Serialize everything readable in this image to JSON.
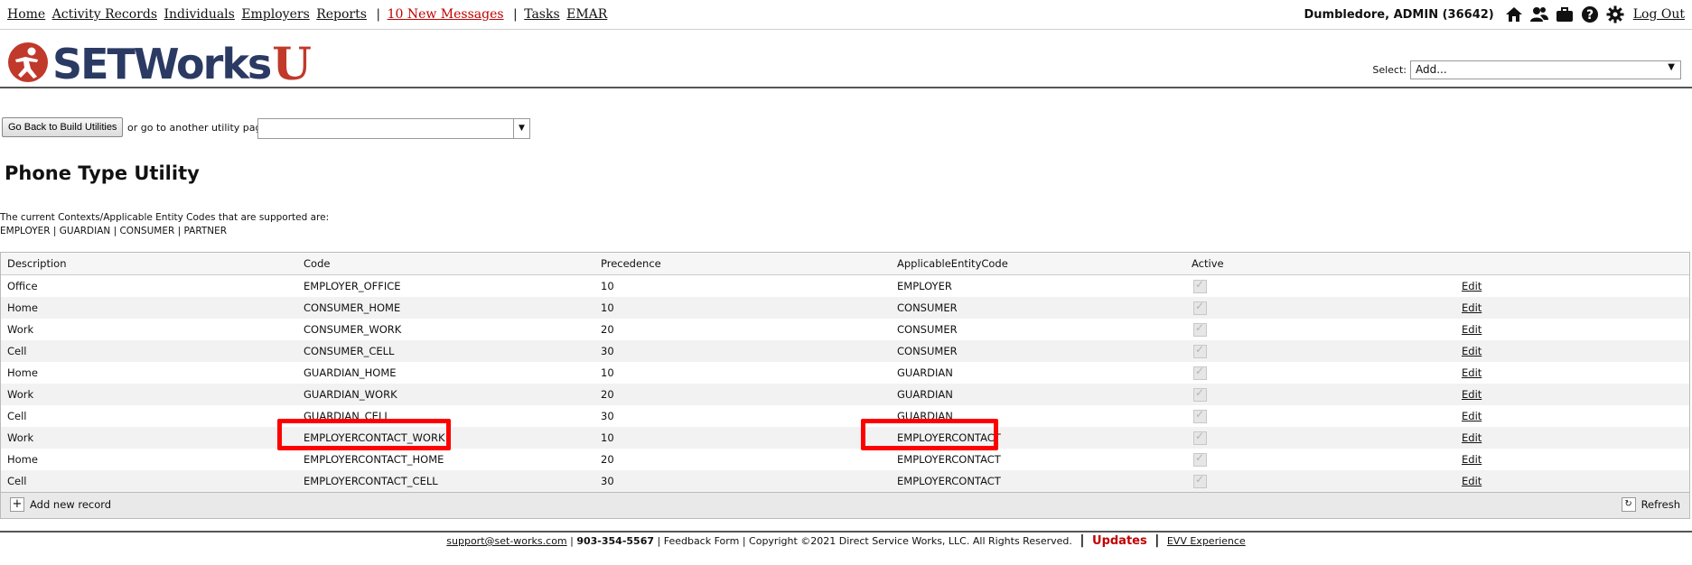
{
  "nav": {
    "links": [
      {
        "label": "Home"
      },
      {
        "label": "Activity Records"
      },
      {
        "label": "Individuals"
      },
      {
        "label": "Employers"
      },
      {
        "label": "Reports"
      }
    ],
    "messages": "10 New Messages",
    "tasks": "Tasks",
    "emar": "EMAR",
    "user": "Dumbledore, ADMIN  (36642)",
    "logout": "Log Out",
    "icons": [
      "home-icon",
      "people-icon",
      "briefcase-icon",
      "help-icon",
      "gear-icon"
    ]
  },
  "header": {
    "logo_text": "SETWorks",
    "logo_u": "U",
    "select_label": "Select:",
    "select_value": "Add..."
  },
  "utility": {
    "back_button": "Go Back to Build Utilities",
    "goto_label": "or go to another utility page:",
    "title": "Phone Type Utility",
    "context_line1": "The current Contexts/Applicable Entity Codes that are supported are:",
    "context_line2": "EMPLOYER | GUARDIAN | CONSUMER | PARTNER"
  },
  "grid": {
    "columns": [
      "Description",
      "Code",
      "Precedence",
      "ApplicableEntityCode",
      "Active"
    ],
    "edit_label": "Edit",
    "rows": [
      {
        "description": "Office",
        "code": "EMPLOYER_OFFICE",
        "precedence": "10",
        "entity": "EMPLOYER",
        "active": true
      },
      {
        "description": "Home",
        "code": "CONSUMER_HOME",
        "precedence": "10",
        "entity": "CONSUMER",
        "active": true
      },
      {
        "description": "Work",
        "code": "CONSUMER_WORK",
        "precedence": "20",
        "entity": "CONSUMER",
        "active": true
      },
      {
        "description": "Cell",
        "code": "CONSUMER_CELL",
        "precedence": "30",
        "entity": "CONSUMER",
        "active": true
      },
      {
        "description": "Home",
        "code": "GUARDIAN_HOME",
        "precedence": "10",
        "entity": "GUARDIAN",
        "active": true
      },
      {
        "description": "Work",
        "code": "GUARDIAN_WORK",
        "precedence": "20",
        "entity": "GUARDIAN",
        "active": true
      },
      {
        "description": "Cell",
        "code": "GUARDIAN_CELL",
        "precedence": "30",
        "entity": "GUARDIAN",
        "active": true
      },
      {
        "description": "Work",
        "code": "EMPLOYERCONTACT_WORK",
        "precedence": "10",
        "entity": "EMPLOYERCONTACT",
        "active": true
      },
      {
        "description": "Home",
        "code": "EMPLOYERCONTACT_HOME",
        "precedence": "20",
        "entity": "EMPLOYERCONTACT",
        "active": true
      },
      {
        "description": "Cell",
        "code": "EMPLOYERCONTACT_CELL",
        "precedence": "30",
        "entity": "EMPLOYERCONTACT",
        "active": true
      }
    ],
    "add_label": "Add new record",
    "refresh_label": "Refresh"
  },
  "footer": {
    "email": "support@set-works.com",
    "phone": "903-354-5567",
    "feedback": "Feedback Form",
    "copyright": "Copyright ©2021 Direct Service Works, LLC. All Rights Reserved.",
    "updates": "Updates",
    "evv": "EVV Experience"
  },
  "colors": {
    "accent_red": "#c00000",
    "logo_blue": "#2b3a63",
    "logo_red": "#c0392b",
    "highlight": "#ff0000"
  }
}
